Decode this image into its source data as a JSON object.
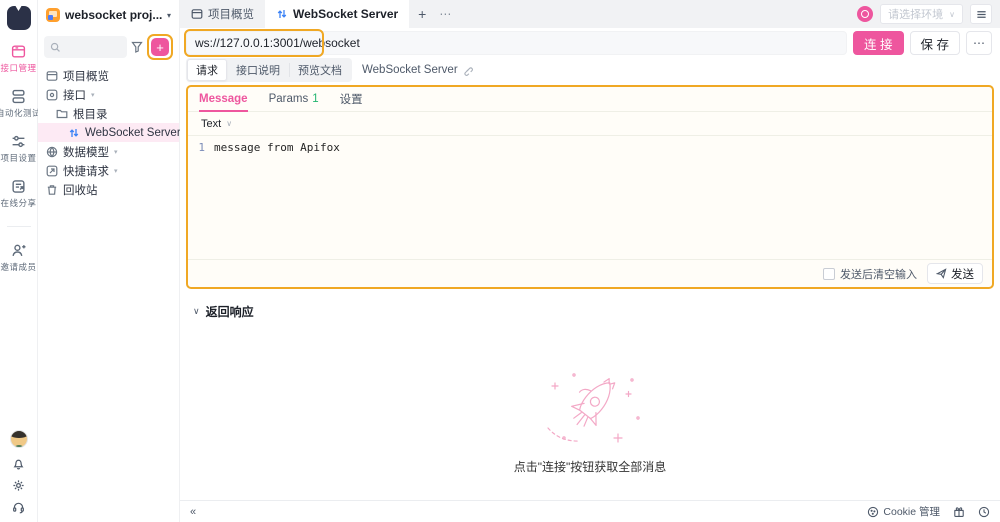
{
  "colors": {
    "accent_pink": "#ee569e",
    "annotation_orange": "#f0a824",
    "count_green": "#23b571",
    "websocket_blue": "#3b82f6",
    "selected_row_bg": "#fdeaf4"
  },
  "icons": {
    "caret_down": "▾",
    "chevron_down": "∨",
    "more": "⋯",
    "plus": "+",
    "collapse": "«"
  },
  "rail": {
    "items": [
      {
        "label": "接口管理"
      },
      {
        "label": "自动化测试"
      },
      {
        "label": "项目设置"
      },
      {
        "label": "在线分享"
      }
    ],
    "invite_label": "邀请成员"
  },
  "sidebar": {
    "project_name": "websocket proj...",
    "tree": [
      {
        "label": "项目概览"
      },
      {
        "label": "接口"
      },
      {
        "label": "根目录"
      },
      {
        "label": "WebSocket Server"
      },
      {
        "label": "数据模型"
      },
      {
        "label": "快捷请求"
      },
      {
        "label": "回收站"
      }
    ]
  },
  "tabs": {
    "items": [
      {
        "label": "项目概览"
      },
      {
        "label": "WebSocket Server"
      }
    ]
  },
  "topbar": {
    "env_placeholder": "请选择环境"
  },
  "toolbar": {
    "url": "ws://127.0.0.1:3001/websocket",
    "connect_label": "连 接",
    "save_label": "保 存"
  },
  "request_tabs": {
    "items": [
      {
        "label": "请求"
      },
      {
        "label": "接口说明"
      },
      {
        "label": "预览文档"
      }
    ],
    "endpoint_name": "WebSocket Server"
  },
  "message_panel": {
    "tabs": [
      {
        "label": "Message"
      },
      {
        "label": "Params",
        "count": "1"
      },
      {
        "label": "设置"
      }
    ],
    "type_label": "Text",
    "editor": {
      "line_number": "1",
      "content": "message from Apifox"
    },
    "clear_label": "发送后清空输入",
    "send_label": "发送"
  },
  "response": {
    "header": "返回响应",
    "empty_hint": "点击\"连接\"按钮获取全部消息"
  },
  "statusbar": {
    "cookie_label": "Cookie 管理"
  }
}
